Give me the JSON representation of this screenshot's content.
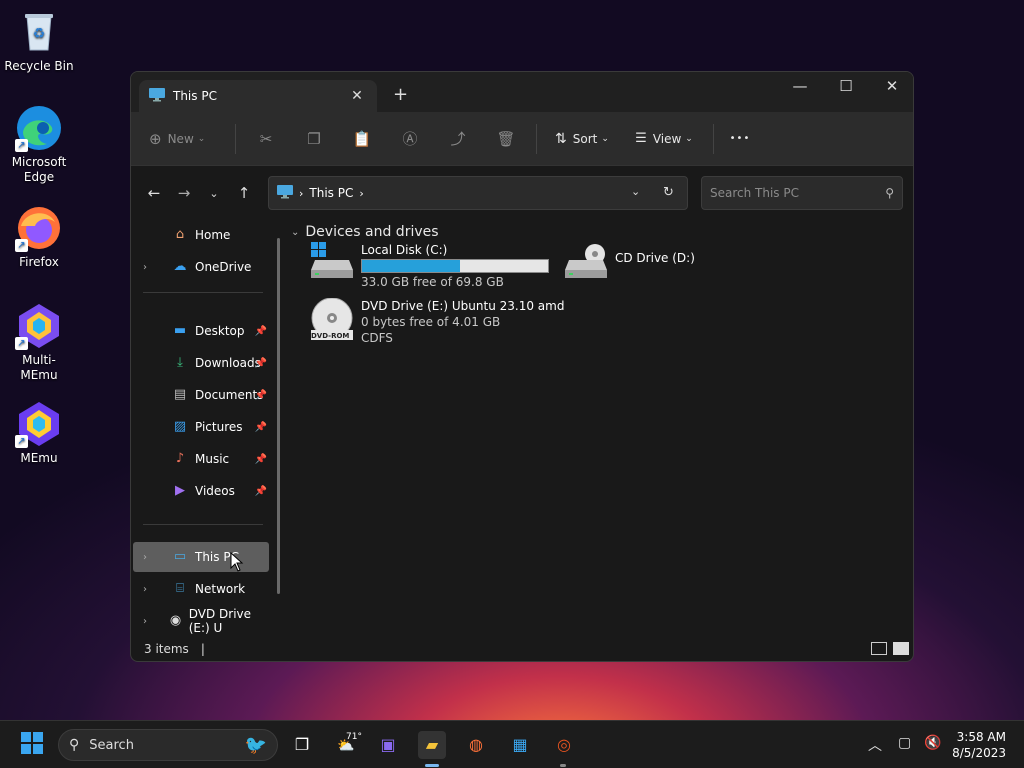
{
  "desktop": {
    "icons": [
      {
        "label": "Recycle Bin"
      },
      {
        "label": "Microsoft Edge"
      },
      {
        "label": "Firefox"
      },
      {
        "label": "Multi-MEmu"
      },
      {
        "label": "MEmu"
      }
    ]
  },
  "window": {
    "tab_title": "This PC",
    "toolbar": {
      "new_label": "New",
      "sort_label": "Sort",
      "view_label": "View",
      "more_label": "•••"
    },
    "address": {
      "crumb": "This PC"
    },
    "search_placeholder": "Search This PC",
    "sidebar": {
      "items": [
        {
          "label": "Home"
        },
        {
          "label": "OneDrive"
        },
        {
          "label": "Desktop"
        },
        {
          "label": "Downloads"
        },
        {
          "label": "Documents"
        },
        {
          "label": "Pictures"
        },
        {
          "label": "Music"
        },
        {
          "label": "Videos"
        },
        {
          "label": "This PC"
        },
        {
          "label": "Network"
        },
        {
          "label": "DVD Drive (E:) U"
        }
      ]
    },
    "content": {
      "section_title": "Devices and drives",
      "drives": [
        {
          "name": "Local Disk (C:)",
          "free": "33.0 GB free of 69.8 GB",
          "used_fraction": 0.527
        },
        {
          "name": "CD Drive (D:)"
        },
        {
          "name": "DVD Drive (E:) Ubuntu 23.10 amd",
          "free": "0 bytes free of 4.01 GB",
          "fs": "CDFS",
          "badge": "DVD-ROM"
        }
      ]
    },
    "status": {
      "items_count": "3 items"
    }
  },
  "taskbar": {
    "search_label": "Search",
    "weather": "71°",
    "time": "3:58 AM",
    "date": "8/5/2023"
  },
  "colors": {
    "accent": "#26a0da",
    "window_bg": "#191919",
    "taskbar_bg": "#1c1c1c"
  }
}
